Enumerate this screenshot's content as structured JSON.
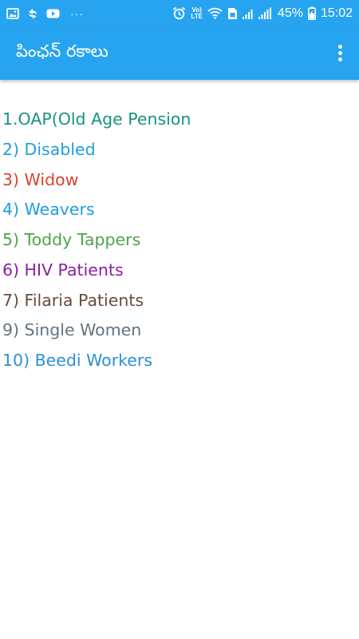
{
  "status_bar": {
    "left_icons": [
      "gallery-icon",
      "sync-icon",
      "youtube-icon"
    ],
    "more_dots": "···",
    "volte_label_top": "Vo)",
    "volte_label_bottom": "LTE",
    "battery_percent": "45%",
    "time": "15:02"
  },
  "app_bar": {
    "title": "పింఛన్ రకాలు",
    "menu_icon": "more-vert-icon"
  },
  "pension_types": [
    {
      "label": "1.OAP(Old Age Pension",
      "color": "#16937f"
    },
    {
      "label": "2) Disabled",
      "color": "#1e9ede"
    },
    {
      "label": "3) Widow",
      "color": "#d8432f"
    },
    {
      "label": "4) Weavers",
      "color": "#1e9ede"
    },
    {
      "label": "5) Toddy Tappers",
      "color": "#4ea34d"
    },
    {
      "label": "6) HIV Patients",
      "color": "#8e1ea3"
    },
    {
      "label": "7) Filaria Patients",
      "color": "#6b4a3c"
    },
    {
      "label": "9) Single Women",
      "color": "#637481"
    },
    {
      "label": "10) Beedi Workers",
      "color": "#2d8fd6"
    }
  ]
}
